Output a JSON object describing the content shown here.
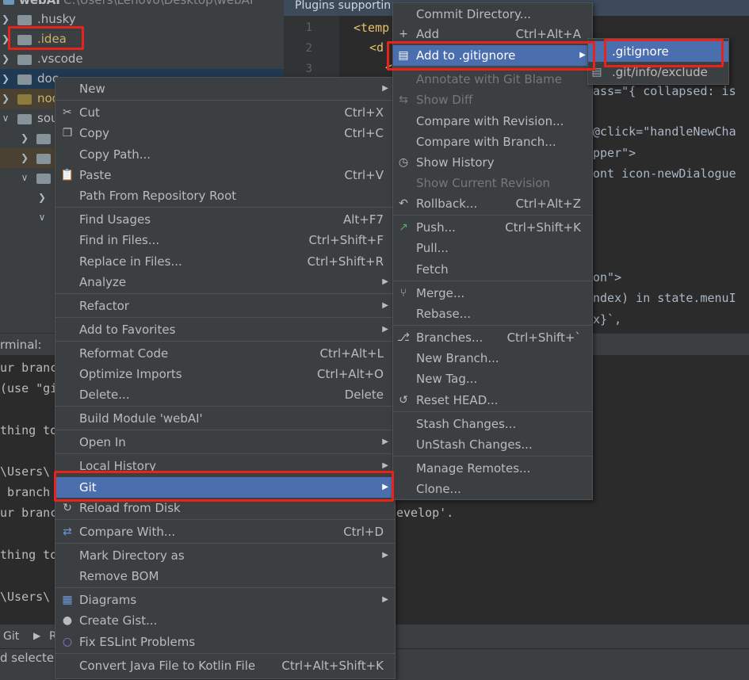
{
  "tree": {
    "header_name": "webAI",
    "header_path": "C:\\Users\\Lenovo\\Desktop\\webAI",
    "items": [
      {
        "label": ".husky"
      },
      {
        "label": ".idea"
      },
      {
        "label": ".vscode"
      },
      {
        "label": "doc"
      },
      {
        "label": "nod"
      },
      {
        "label": "sou"
      }
    ]
  },
  "editor": {
    "tab_title": "Plugins supportin",
    "line_numbers": [
      "1",
      "2",
      "3"
    ],
    "code_lines": [
      "<temp",
      "<d",
      "<",
      "ass=\"{ collapsed: is",
      "@click=\"handleNewCha",
      "pper\">",
      "ont icon-newDialogue",
      "on\">",
      "ndex) in state.menuI",
      "x}`,"
    ]
  },
  "terminal": {
    "header": "rminal:",
    "lines": [
      "ur branc",
      "(use \"gi",
      "thing to",
      "\\Users\\",
      " branch",
      "ur branc",
      "thing to",
      "\\Users\\"
    ],
    "right_text": "evelop'."
  },
  "bottom": {
    "git": "Git",
    "r": "R"
  },
  "status": {
    "text": "d selected"
  },
  "context_menu": {
    "items": [
      {
        "label": "New",
        "submenu": true
      },
      {
        "label": "Cut",
        "shortcut": "Ctrl+X",
        "icon": "cut-icon"
      },
      {
        "label": "Copy",
        "shortcut": "Ctrl+C",
        "icon": "copy-icon"
      },
      {
        "label": "Copy Path..."
      },
      {
        "label": "Paste",
        "shortcut": "Ctrl+V",
        "icon": "paste-icon"
      },
      {
        "label": "Path From Repository Root"
      },
      {
        "label": "Find Usages",
        "shortcut": "Alt+F7"
      },
      {
        "label": "Find in Files...",
        "shortcut": "Ctrl+Shift+F"
      },
      {
        "label": "Replace in Files...",
        "shortcut": "Ctrl+Shift+R"
      },
      {
        "label": "Analyze",
        "submenu": true
      },
      {
        "label": "Refactor",
        "submenu": true
      },
      {
        "label": "Add to Favorites",
        "submenu": true
      },
      {
        "label": "Reformat Code",
        "shortcut": "Ctrl+Alt+L"
      },
      {
        "label": "Optimize Imports",
        "shortcut": "Ctrl+Alt+O"
      },
      {
        "label": "Delete...",
        "shortcut": "Delete"
      },
      {
        "label": "Build Module 'webAI'"
      },
      {
        "label": "Open In",
        "submenu": true
      },
      {
        "label": "Local History",
        "submenu": true
      },
      {
        "label": "Git",
        "submenu": true
      },
      {
        "label": "Reload from Disk",
        "icon": "reload-icon"
      },
      {
        "label": "Compare With...",
        "shortcut": "Ctrl+D",
        "icon": "compare-icon"
      },
      {
        "label": "Mark Directory as",
        "submenu": true
      },
      {
        "label": "Remove BOM"
      },
      {
        "label": "Diagrams",
        "submenu": true,
        "icon": "diagrams-icon"
      },
      {
        "label": "Create Gist...",
        "icon": "github-icon"
      },
      {
        "label": "Fix ESLint Problems",
        "icon": "eslint-icon"
      },
      {
        "label": "Convert Java File to Kotlin File",
        "shortcut": "Ctrl+Alt+Shift+K"
      }
    ]
  },
  "git_menu": {
    "items": [
      {
        "label": "Commit Directory..."
      },
      {
        "label": "Add",
        "shortcut": "Ctrl+Alt+A",
        "icon": "plus-icon"
      },
      {
        "label": "Add to .gitignore",
        "submenu": true,
        "icon": "gitignore-icon"
      },
      {
        "label": "Annotate with Git Blame"
      },
      {
        "label": "Show Diff",
        "icon": "diff-icon"
      },
      {
        "label": "Compare with Revision..."
      },
      {
        "label": "Compare with Branch..."
      },
      {
        "label": "Show History",
        "icon": "history-icon"
      },
      {
        "label": "Show Current Revision"
      },
      {
        "label": "Rollback...",
        "shortcut": "Ctrl+Alt+Z",
        "icon": "rollback-icon"
      },
      {
        "label": "Push...",
        "shortcut": "Ctrl+Shift+K",
        "icon": "push-icon"
      },
      {
        "label": "Pull..."
      },
      {
        "label": "Fetch"
      },
      {
        "label": "Merge...",
        "icon": "merge-icon"
      },
      {
        "label": "Rebase..."
      },
      {
        "label": "Branches...",
        "shortcut": "Ctrl+Shift+`",
        "icon": "branch-icon"
      },
      {
        "label": "New Branch..."
      },
      {
        "label": "New Tag..."
      },
      {
        "label": "Reset HEAD...",
        "icon": "reset-icon"
      },
      {
        "label": "Stash Changes..."
      },
      {
        "label": "UnStash Changes..."
      },
      {
        "label": "Manage Remotes..."
      },
      {
        "label": "Clone..."
      }
    ]
  },
  "gitignore_menu": {
    "items": [
      {
        "label": ".gitignore"
      },
      {
        "label": ".git/info/exclude",
        "icon": "gitignore-icon"
      }
    ]
  },
  "colors": {
    "highlight": "#4b6eaf",
    "annotation": "#e8231c",
    "menu_bg": "#3c3f41"
  }
}
